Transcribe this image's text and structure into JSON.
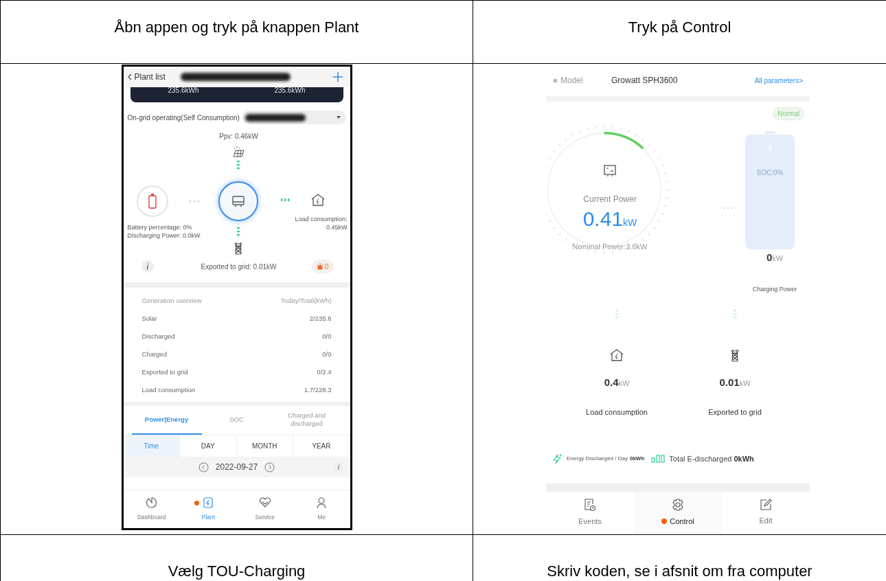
{
  "steps": [
    {
      "heading": "Åbn appen og tryk på knappen Plant"
    },
    {
      "heading": "Tryk på Control"
    },
    {
      "heading": "Vælg TOU-Charging"
    },
    {
      "heading": "Skriv koden, se i afsnit om fra computer"
    }
  ],
  "plant_screen": {
    "back_label": "Plant list",
    "banner_values": [
      "235.6kWh",
      "235.6kWh"
    ],
    "mode": "On-grid operating(Self Consumption)",
    "flow": {
      "ppv": "Ppv: 0.46kW",
      "battery_percentage": "Battery percentage: 0%",
      "discharging_power": "Discharging Power: 0.0kW",
      "load_label": "Load consumption:",
      "load_value": "0.45kW",
      "exported": "Exported to grid: 0.01kW",
      "alarm_count": "0"
    },
    "overview": {
      "title": "Generation overview",
      "unit": "Today/Total(kWh)",
      "rows": [
        {
          "label": "Solar",
          "value": "2/235.6"
        },
        {
          "label": "Discharged",
          "value": "0/0"
        },
        {
          "label": "Charged",
          "value": "0/0"
        },
        {
          "label": "Exported to grid",
          "value": "0/2.4"
        },
        {
          "label": "Load consumption",
          "value": "1.7/228.3"
        }
      ]
    },
    "tabs": [
      {
        "label": "Power|Energy",
        "selected": true
      },
      {
        "label": "SOC",
        "selected": false
      },
      {
        "label": "Charged and discharged",
        "selected": false
      }
    ],
    "ranges": [
      {
        "label": "Time",
        "selected": true
      },
      {
        "label": "DAY",
        "selected": false
      },
      {
        "label": "MONTH",
        "selected": false
      },
      {
        "label": "YEAR",
        "selected": false
      }
    ],
    "date": "2022-09-27",
    "nav": [
      {
        "label": "Dashboard",
        "selected": false
      },
      {
        "label": "Plant",
        "selected": true
      },
      {
        "label": "Service",
        "selected": false
      },
      {
        "label": "Me",
        "selected": false
      }
    ]
  },
  "control_screen": {
    "model_label": "Model",
    "model": "Growatt SPH3600",
    "all_parameters": "All parameters>",
    "status": "Normal",
    "current_power_label": "Current Power",
    "current_power": "0.41",
    "current_power_unit": "kW",
    "level": 0.12,
    "nominal_power": "Nominal Power:3.6kW",
    "soc": "SOC:0%",
    "charging_value": "0",
    "charging_unit": "kW",
    "charging_label": "Charging Power",
    "load_value": "0.4",
    "load_unit": "kW",
    "load_label": "Load consumption",
    "grid_value": "0.01",
    "grid_unit": "kW",
    "grid_label": "Exported to grid",
    "energy_day_label": "Energy Discharged / Day",
    "energy_day_value": "0kWh",
    "energy_total_label": "Total E-discharged",
    "energy_total_value": "0kWh",
    "nav": [
      {
        "label": "Events",
        "selected": false
      },
      {
        "label": "Control",
        "selected": true
      },
      {
        "label": "Edit",
        "selected": false
      }
    ]
  }
}
